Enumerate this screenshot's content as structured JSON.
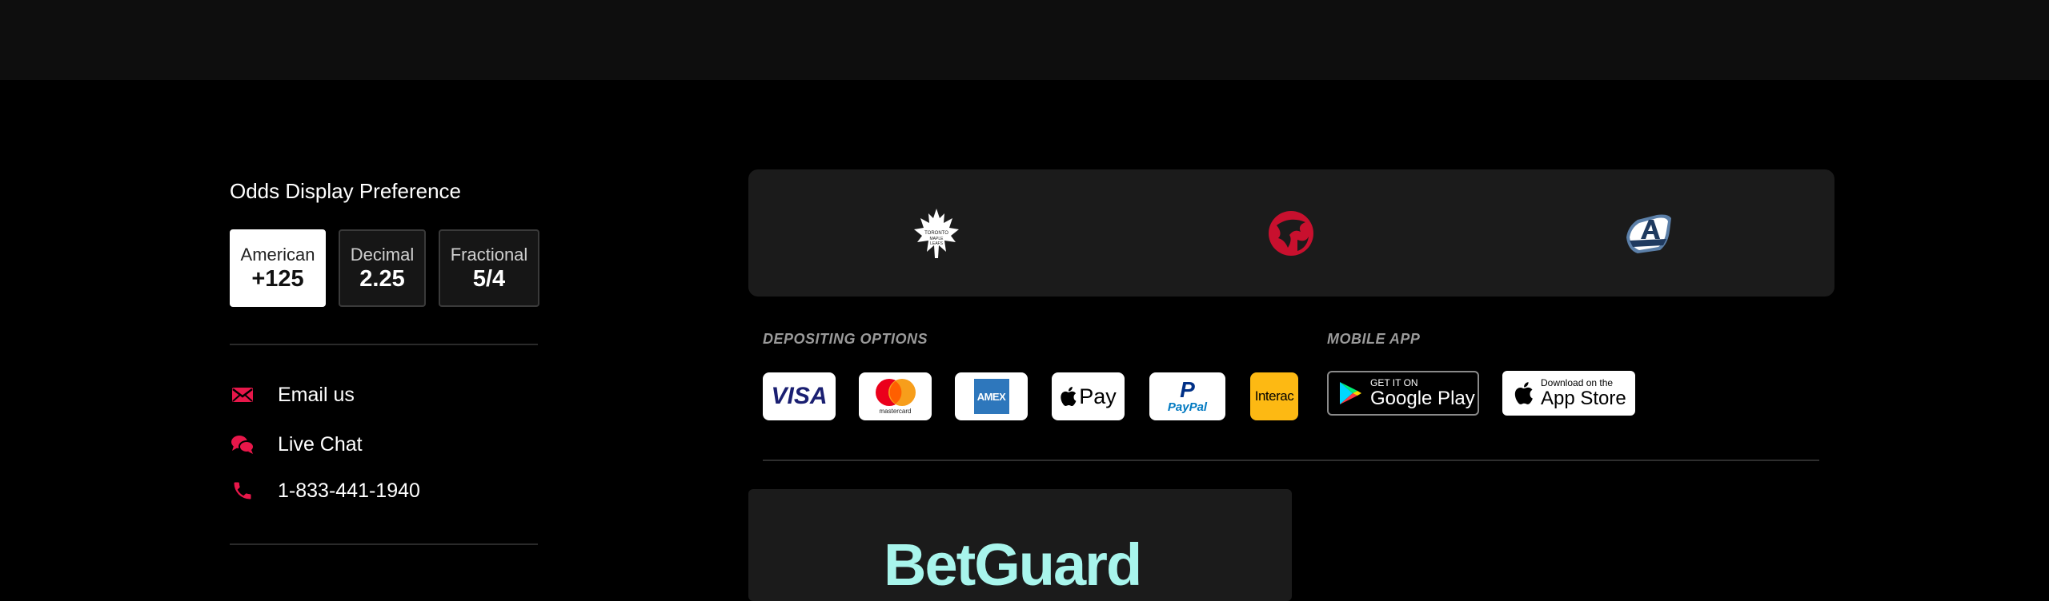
{
  "odds": {
    "title": "Odds Display Preference",
    "options": [
      {
        "label": "American",
        "value": "+125",
        "active": true
      },
      {
        "label": "Decimal",
        "value": "2.25",
        "active": false
      },
      {
        "label": "Fractional",
        "value": "5/4",
        "active": false
      }
    ]
  },
  "contact": {
    "email": "Email us",
    "chat": "Live Chat",
    "phone": "1-833-441-1940"
  },
  "teams": [
    "maple-leafs-logo",
    "raptors-logo",
    "argonauts-logo"
  ],
  "depositing": {
    "label": "DEPOSITING OPTIONS",
    "methods": [
      "VISA",
      "mastercard",
      "AMEX",
      "Pay",
      "PayPal",
      "Interac"
    ]
  },
  "mobile": {
    "label": "MOBILE APP",
    "google_small": "GET IT ON",
    "google_big": "Google Play",
    "apple_small": "Download on the",
    "apple_big": "App Store"
  },
  "betguard": "BetGuard",
  "colors": {
    "accent": "#e8174a",
    "background": "#000000",
    "panel": "#1b1b1b"
  }
}
